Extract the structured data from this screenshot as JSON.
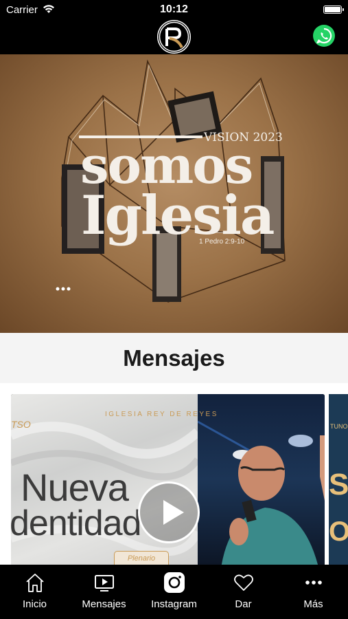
{
  "status_bar": {
    "carrier": "Carrier",
    "time": "10:12"
  },
  "header": {
    "logo_icon": "church-logo-icon",
    "whatsapp_icon": "whatsapp-icon"
  },
  "hero": {
    "line1": "somos",
    "line2": "Iglesia",
    "vision": "VISION 2023",
    "verse": "1 Pedro 2:9-10"
  },
  "section": {
    "title": "Mensajes"
  },
  "message_card": {
    "church": "IGLESIA REY DE REYES",
    "title_line1": "Nueva",
    "title_line2": "dentidad",
    "badge": "Plenario",
    "corner": "TSO"
  },
  "next_card": {
    "top_text": "TUNO",
    "letter1": "S",
    "letter2": "O"
  },
  "tabs": [
    {
      "label": "Inicio",
      "icon": "home-icon"
    },
    {
      "label": "Mensajes",
      "icon": "tv-play-icon"
    },
    {
      "label": "Instagram",
      "icon": "instagram-icon"
    },
    {
      "label": "Dar",
      "icon": "heart-icon"
    },
    {
      "label": "Más",
      "icon": "more-dots-icon"
    }
  ],
  "colors": {
    "accent": "#c99a55",
    "whatsapp": "#25d366",
    "hero_bg": "#9b7248"
  }
}
